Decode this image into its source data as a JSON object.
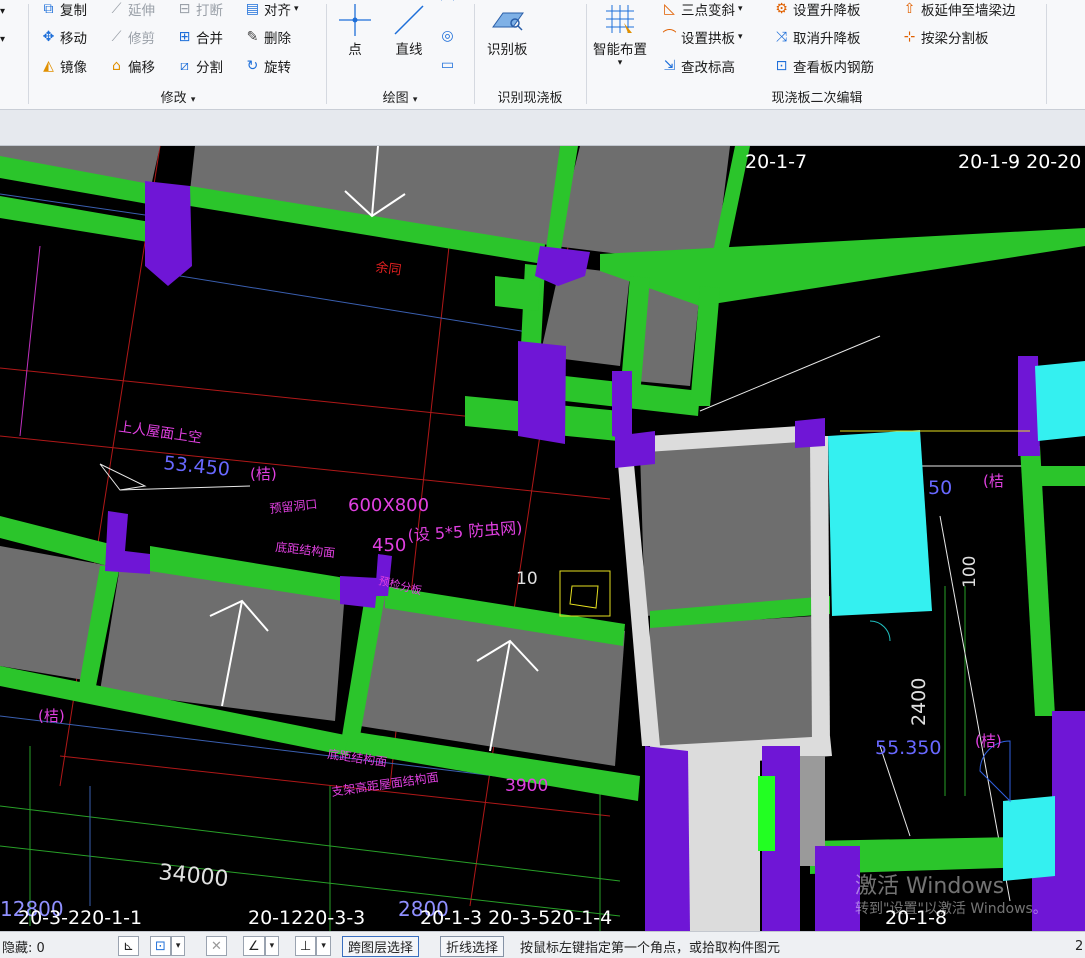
{
  "ribbon": {
    "modify_group": {
      "label": "修改",
      "items": {
        "copy": "复制",
        "extend": "延伸",
        "break": "打断",
        "align": "对齐",
        "move": "移动",
        "trim": "修剪",
        "merge": "合并",
        "delete": "删除",
        "mirror": "镜像",
        "offset": "偏移",
        "split": "分割",
        "rotate": "旋转"
      }
    },
    "draw_group": {
      "label": "绘图",
      "point": "点",
      "line": "直线"
    },
    "identify_group": {
      "label": "识别现浇板",
      "identify_slab": "识别板"
    },
    "edit_group": {
      "label": "现浇板二次编辑",
      "smart_layout": "智能布置",
      "three_point_slope": "三点变斜",
      "set_arch": "设置拱板",
      "check_elevation": "查改标高",
      "set_raise": "设置升降板",
      "cancel_raise": "取消升降板",
      "view_rebar": "查看板内钢筋",
      "extend_to_wall": "板延伸至墙梁边",
      "split_by_beam": "按梁分割板"
    }
  },
  "cad": {
    "labels": {
      "axis_top_a": "20-1-7",
      "axis_top_b": "20-1-9  20-20",
      "yu_tong": "余同",
      "roof_access": "上人屋面上空",
      "elev_a": "53.450",
      "jie_a": "(桔)",
      "reserved_opening": "预留洞口",
      "opening_size": "600X800",
      "bottom_to_struct": "底距结构面",
      "dim_450": "450",
      "mesh_note": "(设 5*5 防虫网)",
      "angle_10": "10",
      "slab_label_cut": "预检分板",
      "note_a": "底距结构面",
      "note_b": "支架高距屋面结构面",
      "dim_3900": "3900",
      "elev_b": "55.350",
      "dim_2400": "2400",
      "dim_100": "100",
      "jie_b": "(桔)",
      "jie_c": "(桔)",
      "jie_d": "(桔",
      "v50": "50",
      "dim_34000": "34000",
      "dim_2800": "2800",
      "dim_12800": "12800",
      "axis_bottom_a": "20-3-220-1-1",
      "axis_bottom_b": "20-1220-3-3",
      "axis_bottom_c": "20-1-3 20-3-520-1-4",
      "axis_bottom_d": "20-1-8"
    },
    "colors": {
      "wall_green": "#2bc52b",
      "column_purple": "#6f16d6",
      "slab_gray": "#6e6e6e",
      "cyan_block": "#34f0f0",
      "light_slab": "#dcdcdc",
      "annotation_red": "#e02020",
      "annotation_magenta": "#e040e0",
      "dim_white": "#ffffff"
    }
  },
  "watermark": {
    "line1": "激活 Windows",
    "line2": "转到\"设置\"以激活 Windows。"
  },
  "status": {
    "hidden_label": "隐藏: 0",
    "cross_layer": "跨图层选择",
    "polyline_select": "折线选择",
    "prompt": "按鼠标左键指定第一个角点，或拾取构件图元",
    "right_value": "2"
  }
}
